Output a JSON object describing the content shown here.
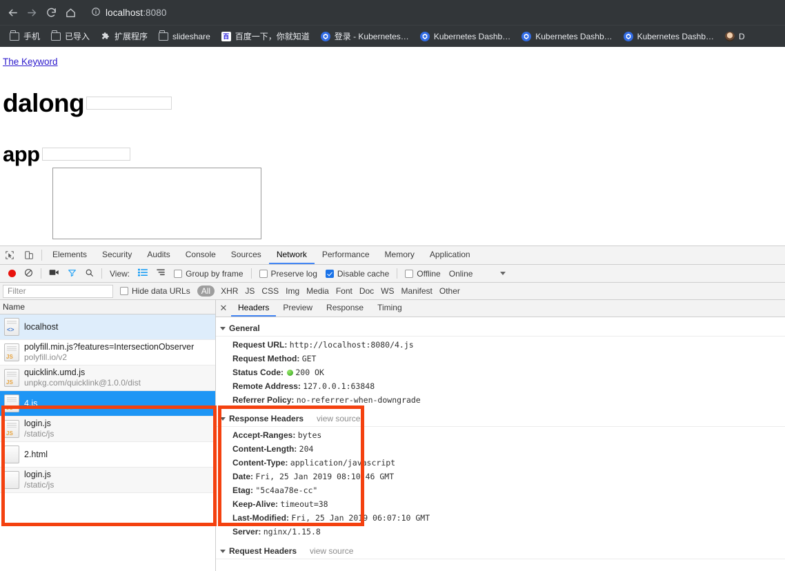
{
  "browser": {
    "nav": {
      "back_icon": "arrow-left-icon",
      "forward_icon": "arrow-right-icon",
      "reload_icon": "reload-icon",
      "home_icon": "home-icon",
      "info_icon": "info-circle-icon"
    },
    "omnibox": {
      "host": "localhost",
      "port": ":8080",
      "full": "localhost:8080"
    },
    "bookmarks": [
      {
        "label": "手机",
        "icon": "folder-icon"
      },
      {
        "label": "已导入",
        "icon": "folder-icon"
      },
      {
        "label": "扩展程序",
        "icon": "puzzle-icon"
      },
      {
        "label": "slideshare",
        "icon": "folder-icon"
      },
      {
        "label": "百度一下，你就知道",
        "icon": "baidu-icon"
      },
      {
        "label": "登录 - Kubernetes…",
        "icon": "kubernetes-icon"
      },
      {
        "label": "Kubernetes Dashb…",
        "icon": "kubernetes-icon"
      },
      {
        "label": "Kubernetes Dashb…",
        "icon": "kubernetes-icon"
      },
      {
        "label": "Kubernetes Dashb…",
        "icon": "kubernetes-icon"
      },
      {
        "label": "D",
        "icon": "avatar-icon"
      }
    ]
  },
  "page": {
    "link": "The Keyword",
    "heading_1": "dalong",
    "heading_2": "app",
    "input_1_value": "",
    "input_2_value": ""
  },
  "devtools": {
    "inspect_icon": "inspect-element-icon",
    "device_icon": "device-toolbar-icon",
    "tabs": [
      {
        "label": "Elements",
        "active": false
      },
      {
        "label": "Security",
        "active": false
      },
      {
        "label": "Audits",
        "active": false
      },
      {
        "label": "Console",
        "active": false
      },
      {
        "label": "Sources",
        "active": false
      },
      {
        "label": "Network",
        "active": true
      },
      {
        "label": "Performance",
        "active": false
      },
      {
        "label": "Memory",
        "active": false
      },
      {
        "label": "Application",
        "active": false
      }
    ],
    "toolbar": {
      "record_icon": "record-button-icon",
      "clear_icon": "clear-icon",
      "camera_icon": "screenshot-camera-icon",
      "filter_icon": "filter-funnel-icon",
      "search_icon": "search-icon",
      "view_label": "View:",
      "view_list_icon": "list-view-icon",
      "view_waterfall_icon": "waterfall-view-icon",
      "group_by_frame": {
        "label": "Group by frame",
        "checked": false
      },
      "preserve_log": {
        "label": "Preserve log",
        "checked": false
      },
      "disable_cache": {
        "label": "Disable cache",
        "checked": true
      },
      "offline": {
        "label": "Offline",
        "checked": false
      },
      "online_label": "Online",
      "throttle_caret_icon": "chevron-down-icon"
    },
    "filterbar": {
      "placeholder": "Filter",
      "value": "",
      "hide_data_urls": {
        "label": "Hide data URLs",
        "checked": false
      },
      "types": [
        "All",
        "XHR",
        "JS",
        "CSS",
        "Img",
        "Media",
        "Font",
        "Doc",
        "WS",
        "Manifest",
        "Other"
      ],
      "active_type": "All"
    },
    "requests": {
      "column_header": "Name",
      "rows": [
        {
          "name": "localhost",
          "sub": "",
          "icon": "document-icon",
          "state": "highlight"
        },
        {
          "name": "polyfill.min.js?features=IntersectionObserver",
          "sub": "polyfill.io/v2",
          "icon": "js-file-icon",
          "state": "normal"
        },
        {
          "name": "quicklink.umd.js",
          "sub": "unpkg.com/quicklink@1.0.0/dist",
          "icon": "js-file-icon",
          "state": "zebra"
        },
        {
          "name": "4.js",
          "sub": "",
          "icon": "js-file-icon",
          "state": "selected"
        },
        {
          "name": "login.js",
          "sub": "/static/js",
          "icon": "js-file-icon",
          "state": "zebra"
        },
        {
          "name": "2.html",
          "sub": "",
          "icon": "plain-file-icon",
          "state": "normal"
        },
        {
          "name": "login.js",
          "sub": "/static/js",
          "icon": "plain-file-icon",
          "state": "zebra"
        }
      ]
    },
    "details": {
      "close_icon": "close-icon",
      "tabs": [
        {
          "label": "Headers",
          "active": true
        },
        {
          "label": "Preview",
          "active": false
        },
        {
          "label": "Response",
          "active": false
        },
        {
          "label": "Timing",
          "active": false
        }
      ],
      "sections": [
        {
          "title": "General",
          "view_source": "",
          "rows": [
            {
              "key": "Request URL:",
              "value": "http://localhost:8080/4.js"
            },
            {
              "key": "Request Method:",
              "value": "GET"
            },
            {
              "key": "Status Code:",
              "value": "200 OK",
              "status_dot": true
            },
            {
              "key": "Remote Address:",
              "value": "127.0.0.1:63848"
            },
            {
              "key": "Referrer Policy:",
              "value": "no-referrer-when-downgrade"
            }
          ]
        },
        {
          "title": "Response Headers",
          "view_source": "view source",
          "rows": [
            {
              "key": "Accept-Ranges:",
              "value": "bytes"
            },
            {
              "key": "Content-Length:",
              "value": "204"
            },
            {
              "key": "Content-Type:",
              "value": "application/javascript"
            },
            {
              "key": "Date:",
              "value": "Fri, 25 Jan 2019 08:10:46 GMT"
            },
            {
              "key": "Etag:",
              "value": "\"5c4aa78e-cc\""
            },
            {
              "key": "Keep-Alive:",
              "value": "timeout=38"
            },
            {
              "key": "Last-Modified:",
              "value": "Fri, 25 Jan 2019 06:07:10 GMT"
            },
            {
              "key": "Server:",
              "value": "nginx/1.15.8"
            }
          ]
        },
        {
          "title": "Request Headers",
          "view_source": "view source",
          "rows": []
        }
      ]
    }
  },
  "annotations": {
    "color": "#f4410f",
    "boxes": [
      {
        "name": "request-list-highlight"
      },
      {
        "name": "response-headers-highlight"
      }
    ]
  }
}
